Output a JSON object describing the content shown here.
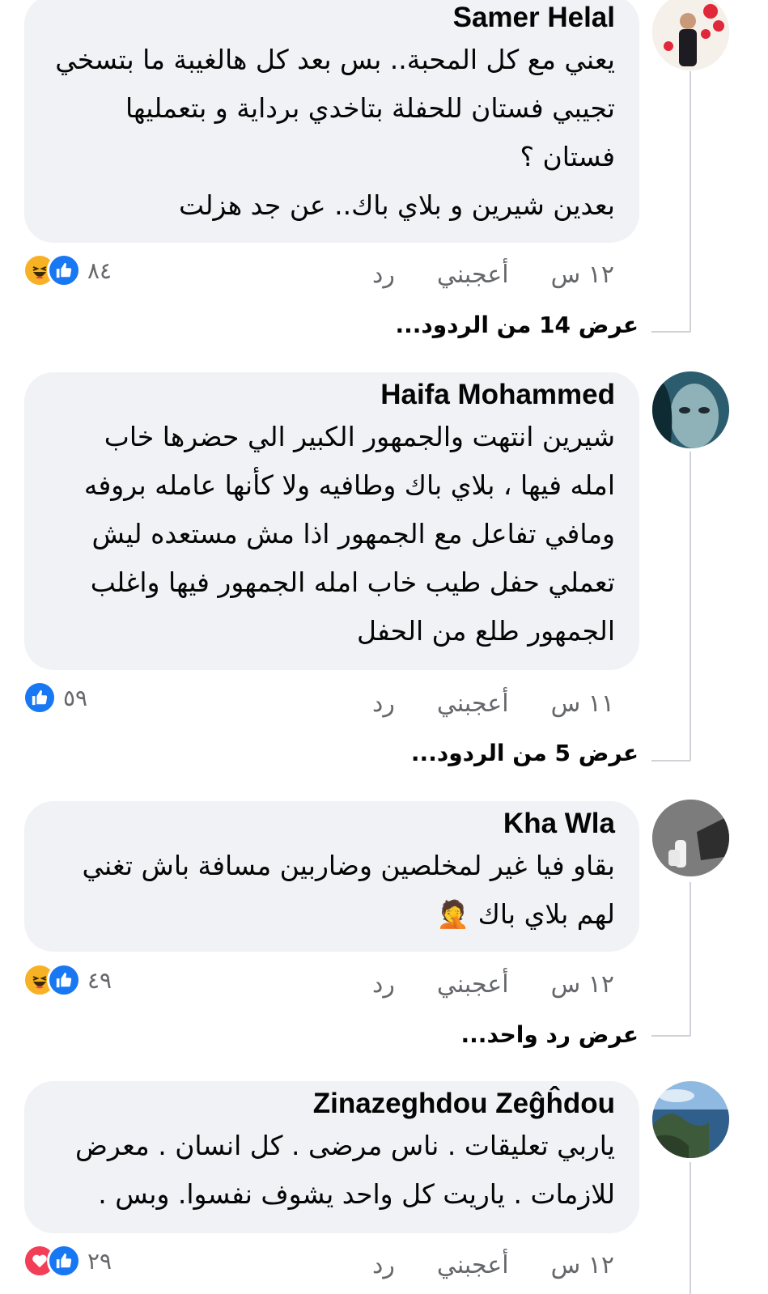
{
  "comments": [
    {
      "author": "Samer Helal",
      "lines": [
        "يعني مع كل المحبة.. بس بعد كل هالغيبة ما بتسخي",
        "تجيبي فستان للحفلة بتاخدي برداية و بتعمليها",
        "فستان ؟",
        "بعدين شيرين و بلاي باك.. عن جد هزلت"
      ],
      "time": "١٢ س",
      "like_label": "أعجبني",
      "reply_label": "رد",
      "reaction_count": "٨٤",
      "reactions": [
        "haha",
        "like"
      ],
      "view_replies": "عرض 14 من الردود..."
    },
    {
      "author": "Haifa Mohammed",
      "lines": [
        "شيرين انتهت والجمهور الكبير الي حضرها خاب",
        "امله فيها ، بلاي باك وطافيه ولا كأنها عامله بروفه",
        "ومافي تفاعل مع الجمهور اذا مش مستعده ليش",
        "تعملي حفل طيب خاب امله الجمهور فيها واغلب",
        "الجمهور طلع من الحفل"
      ],
      "time": "١١ س",
      "like_label": "أعجبني",
      "reply_label": "رد",
      "reaction_count": "٥٩",
      "reactions": [
        "like"
      ],
      "view_replies": "عرض 5 من الردود..."
    },
    {
      "author": "Kha Wla",
      "lines": [
        "بقاو فيا غير لمخلصين وضاربين مسافة باش تغني",
        "لهم بلاي باك 🤦"
      ],
      "time": "١٢ س",
      "like_label": "أعجبني",
      "reply_label": "رد",
      "reaction_count": "٤٩",
      "reactions": [
        "haha",
        "like"
      ],
      "view_replies": "عرض رد واحد..."
    },
    {
      "author": "Zinazeghdou Zeĝĥdou",
      "lines": [
        "ياربي تعليقات . ناس مرضى . كل انسان . معرض",
        "للازمات . ياريت كل واحد يشوف نفسوا. وبس ."
      ],
      "time": "١٢ س",
      "like_label": "أعجبني",
      "reply_label": "رد",
      "reaction_count": "٢٩",
      "reactions": [
        "love",
        "like"
      ]
    }
  ],
  "colors": {
    "bubble": "#f0f2f5",
    "like_blue": "#1877f2",
    "haha_yellow": "#f7b125",
    "love_red": "#f33e58",
    "secondary_text": "#65676b"
  },
  "icons": {
    "like": "thumbs-up-icon",
    "haha": "laughing-face-icon",
    "love": "heart-icon"
  }
}
